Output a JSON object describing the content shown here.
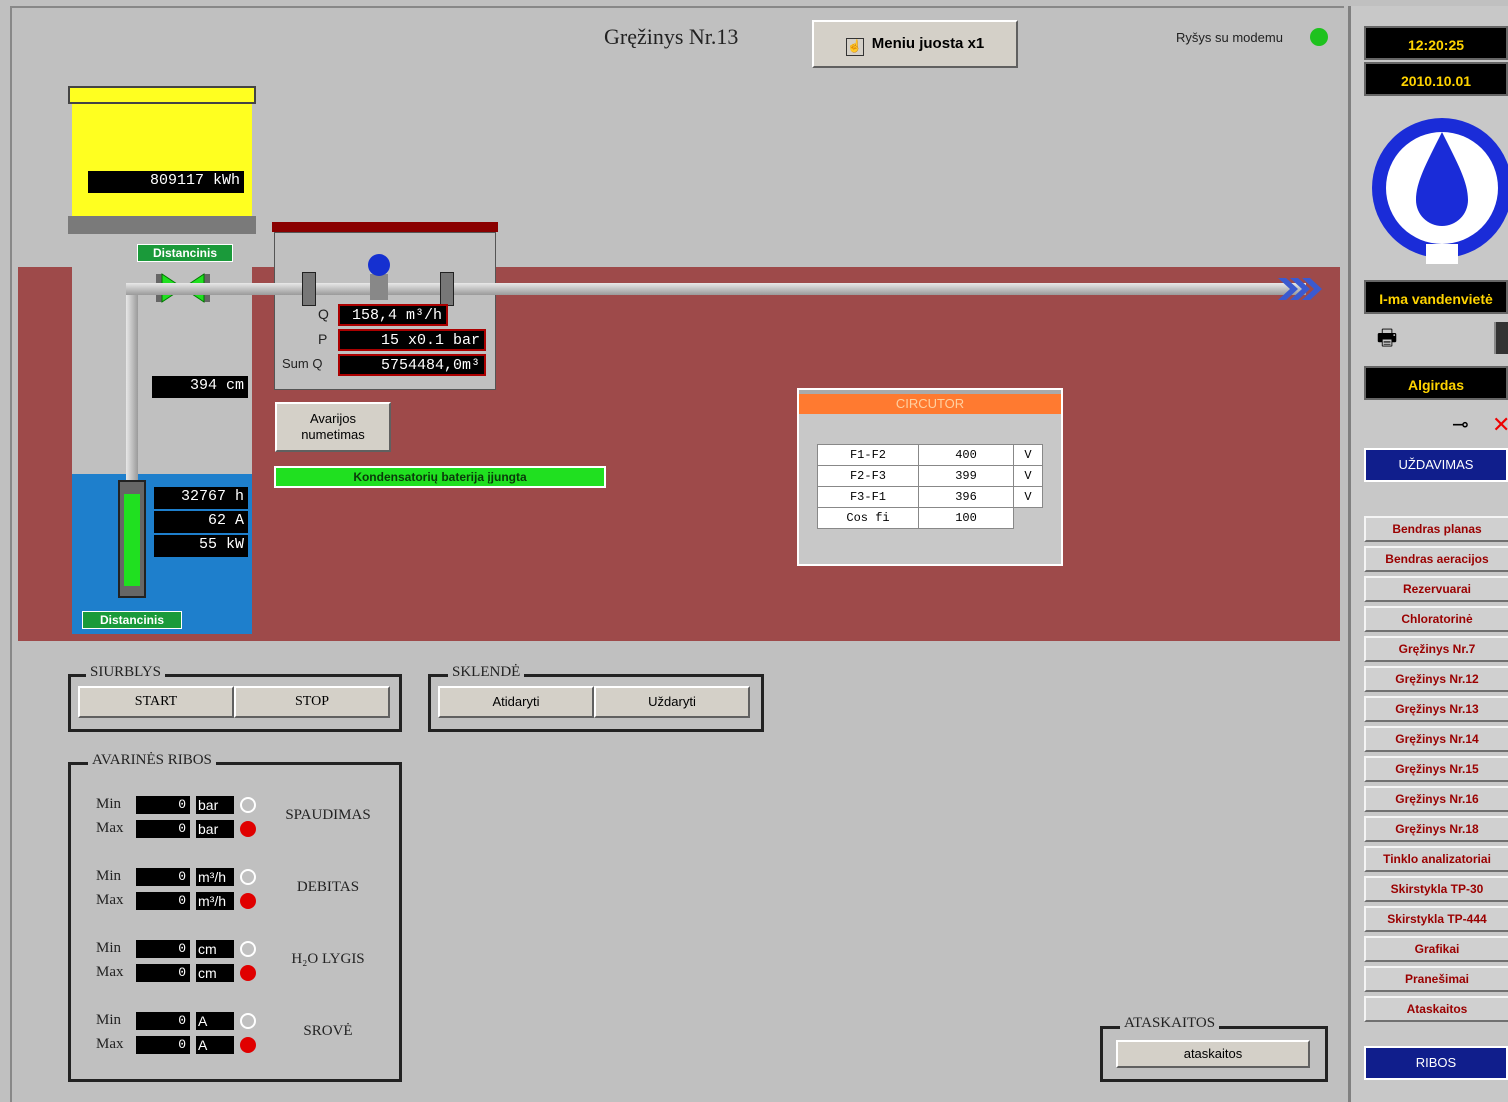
{
  "header": {
    "title": "Gręžinys Nr.13",
    "menu_button": "Meniu juosta x1",
    "modem_status": "Ryšys su modemu",
    "modem_color": "#1ec21e"
  },
  "well": {
    "energy": "809117 kWh",
    "remote_top": "Distancinis",
    "remote_bottom": "Distancinis",
    "level": "394 cm",
    "hours": "32767 h",
    "current": "62 A",
    "power": "55 kW"
  },
  "meter": {
    "q_label": "Q",
    "q_value": "158,4 m³/h",
    "p_label": "P",
    "p_value": "15 x0.1 bar",
    "sum_label": "Sum Q",
    "sum_value": "5754484,0m³"
  },
  "alarm_reset": "Avarijos numetimas",
  "capacitor_status": "Kondensatorių baterija įjungta",
  "circutor": {
    "title": "CIRCUTOR",
    "rows": [
      {
        "name": "F1-F2",
        "value": "400",
        "unit": "V"
      },
      {
        "name": "F2-F3",
        "value": "399",
        "unit": "V"
      },
      {
        "name": "F3-F1",
        "value": "396",
        "unit": "V"
      },
      {
        "name": "Cos fi",
        "value": "100",
        "unit": ""
      }
    ]
  },
  "pump": {
    "legend": "SIURBLYS",
    "start": "START",
    "stop": "STOP"
  },
  "valve": {
    "legend": "SKLENDĖ",
    "open": "Atidaryti",
    "close": "Uždaryti"
  },
  "limits": {
    "legend": "AVARINĖS RIBOS",
    "min_label": "Min",
    "max_label": "Max",
    "groups": [
      {
        "name": "SPAUDIMAS",
        "unit": "bar",
        "min": "0",
        "max": "0"
      },
      {
        "name": "DEBITAS",
        "unit": "m³/h",
        "min": "0",
        "max": "0"
      },
      {
        "name": "H₂O LYGIS",
        "unit": "cm",
        "min": "0",
        "max": "0"
      },
      {
        "name": "SROVĖ",
        "unit": "A",
        "min": "0",
        "max": "0"
      }
    ]
  },
  "reports": {
    "legend": "ATASKAITOS",
    "button": "ataskaitos"
  },
  "sidebar": {
    "time": "12:20:25",
    "date": "2010.10.01",
    "station": "I-ma vandenvietė",
    "user": "Algirdas",
    "task": "UŽDAVIMAS",
    "nav": [
      "Bendras planas",
      "Bendras aeracijos",
      "Rezervuarai",
      "Chloratorinė",
      "Gręžinys Nr.7",
      "Gręžinys Nr.12",
      "Gręžinys Nr.13",
      "Gręžinys Nr.14",
      "Gręžinys Nr.15",
      "Gręžinys Nr.16",
      "Gręžinys Nr.18",
      "Tinklo analizatoriai",
      "Skirstykla TP-30",
      "Skirstykla TP-444",
      "Grafikai",
      "Pranešimai",
      "Ataskaitos"
    ],
    "limits_button": "RIBOS"
  }
}
